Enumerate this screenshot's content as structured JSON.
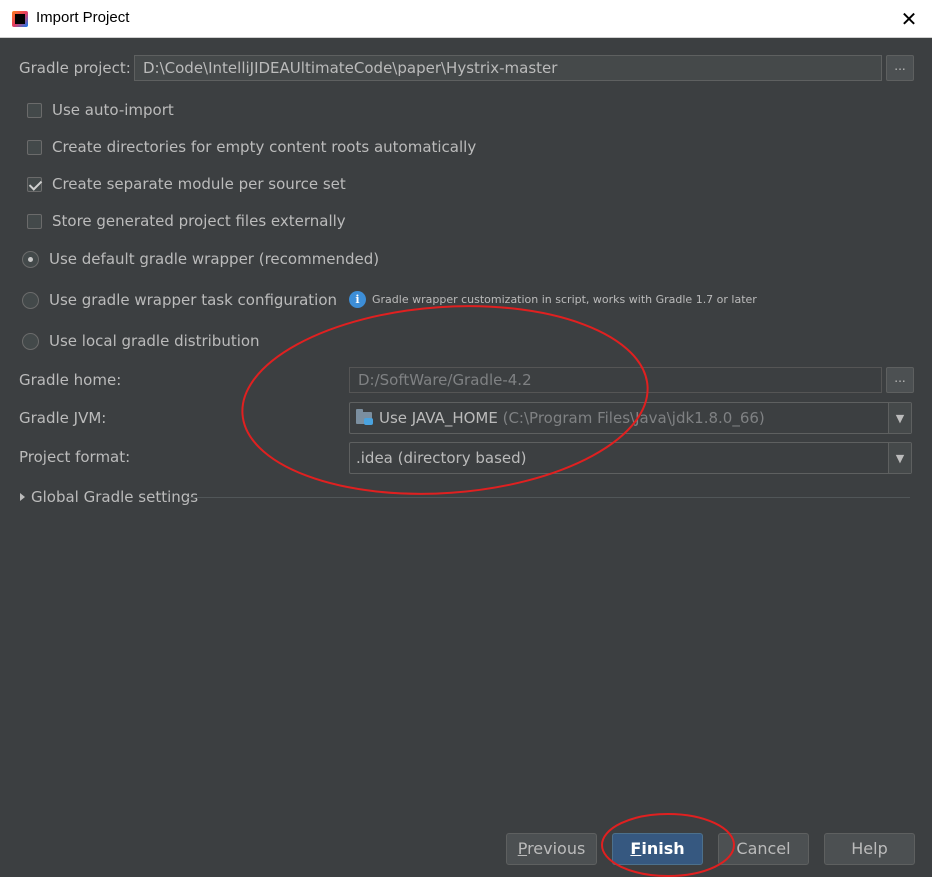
{
  "window": {
    "title": "Import Project",
    "close_glyph": "✕"
  },
  "gradle_project": {
    "label": "Gradle project:",
    "value": "D:\\Code\\IntelliJIDEAUltimateCode\\paper\\Hystrix-master",
    "browse_label": "..."
  },
  "options": {
    "auto_import": {
      "label": "Use auto-import",
      "checked": false
    },
    "create_dirs": {
      "label": "Create directories for empty content roots automatically",
      "checked": false
    },
    "separate_module": {
      "label": "Create separate module per source set",
      "checked": true
    },
    "store_external": {
      "label": "Store generated project files externally",
      "checked": false
    }
  },
  "wrapper": {
    "default": {
      "label": "Use default gradle wrapper (recommended)",
      "selected": true
    },
    "task_config": {
      "label": "Use gradle wrapper task configuration",
      "selected": false
    },
    "local": {
      "label": "Use local gradle distribution",
      "selected": false
    },
    "info_icon": "info-icon",
    "info_glyph": "i",
    "info_text": "Gradle wrapper customization in script, works with Gradle 1.7 or later"
  },
  "gradle_home": {
    "label": "Gradle home:",
    "value": "D:/SoftWare/Gradle-4.2",
    "browse_label": "..."
  },
  "gradle_jvm": {
    "label": "Gradle JVM:",
    "value_main": "Use JAVA_HOME",
    "value_detail": "(C:\\Program Files\\Java\\jdk1.8.0_66)",
    "arrow": "▼"
  },
  "project_format": {
    "label": "Project format:",
    "value": ".idea (directory based)",
    "arrow": "▼"
  },
  "global_settings": {
    "label": "Global Gradle settings"
  },
  "buttons": {
    "previous": {
      "mnemonic": "P",
      "rest": "revious"
    },
    "finish": {
      "mnemonic": "F",
      "rest": "inish"
    },
    "cancel": "Cancel",
    "help": "Help"
  },
  "colors": {
    "background": "#3c3f41",
    "text": "#bbbbbb",
    "default_button": "#365880",
    "annotation_red": "#e02020",
    "info_blue": "#3d8ed7"
  }
}
